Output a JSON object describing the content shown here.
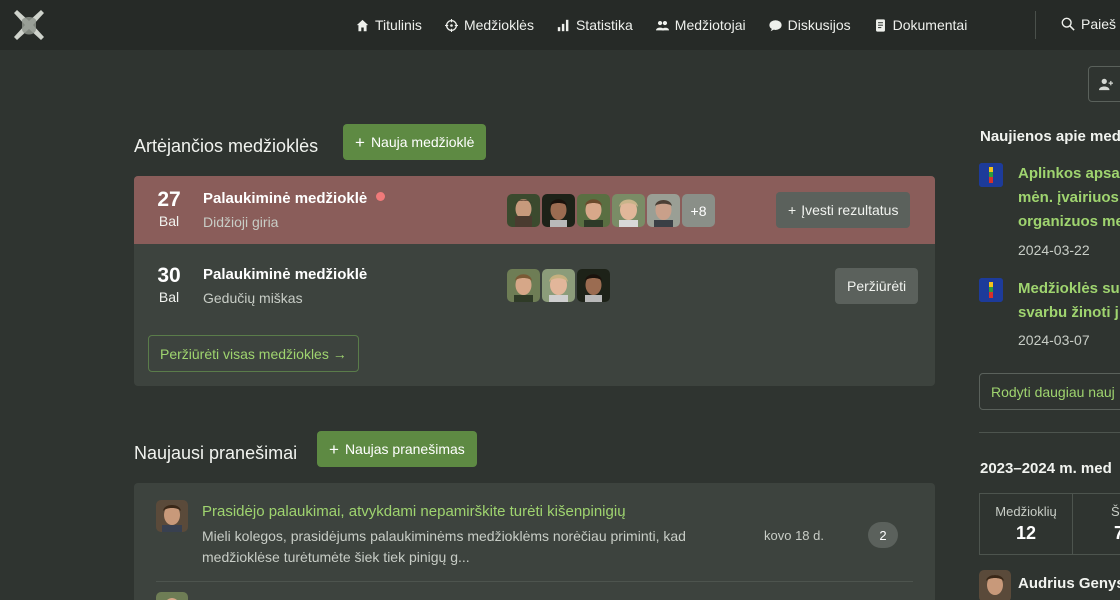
{
  "nav": {
    "items": [
      {
        "label": "Titulinis",
        "icon": "home-icon"
      },
      {
        "label": "Medžioklės",
        "icon": "crosshair-icon"
      },
      {
        "label": "Statistika",
        "icon": "bar-chart-icon"
      },
      {
        "label": "Medžiotojai",
        "icon": "users-icon"
      },
      {
        "label": "Diskusijos",
        "icon": "chat-icon"
      },
      {
        "label": "Dokumentai",
        "icon": "document-icon"
      }
    ],
    "search_label": "Paieš"
  },
  "upcoming": {
    "title": "Artėjančios medžioklės",
    "new_button": "Nauja medžioklė",
    "hunts": [
      {
        "day": "27",
        "month": "Bal",
        "name": "Palaukiminė medžioklė",
        "location": "Didžioji giria",
        "active": true,
        "extra_count": "+8",
        "action": "Įvesti rezultatus"
      },
      {
        "day": "30",
        "month": "Bal",
        "name": "Palaukiminė medžioklė",
        "location": "Gedučių miškas",
        "active": false,
        "action": "Peržiūrėti"
      }
    ],
    "view_all": "Peržiūrėti visas medžiokles →"
  },
  "posts": {
    "title": "Naujausi pranešimai",
    "new_button": "Naujas pranešimas",
    "items": [
      {
        "title": "Prasidėjo palaukimai, atvykdami nepamirškite turėti kišenpinigių",
        "excerpt": "Mieli kolegos, prasidėjums palaukiminėms medžioklėms norėčiau priminti, kad medžioklėse turėtumėte šiek tiek pinigų g...",
        "date": "kovo 18 d.",
        "comments": "2"
      }
    ]
  },
  "news": {
    "title": "Naujienos apie med",
    "items": [
      {
        "title_lines": [
          "Aplinkos apsa",
          "mėn. įvairiuos",
          "organizuos me"
        ],
        "date": "2024-03-22"
      },
      {
        "title_lines": [
          "Medžioklės su",
          "svarbu žinoti j"
        ],
        "date": "2024-03-07"
      }
    ],
    "more_button": "Rodyti daugiau nauj"
  },
  "season": {
    "title": "2023–2024 m. med",
    "stats": [
      {
        "label": "Medžioklių",
        "value": "12"
      },
      {
        "label": "Šū",
        "value": "7"
      }
    ],
    "leader": "Audrius Genys"
  },
  "colors": {
    "background": "#2f3430",
    "topbar": "#262a27",
    "accent_green": "#5e8a43",
    "link_green": "#9fd46f",
    "active_hunt": "#8a5d5a",
    "panel": "#3d433e"
  }
}
